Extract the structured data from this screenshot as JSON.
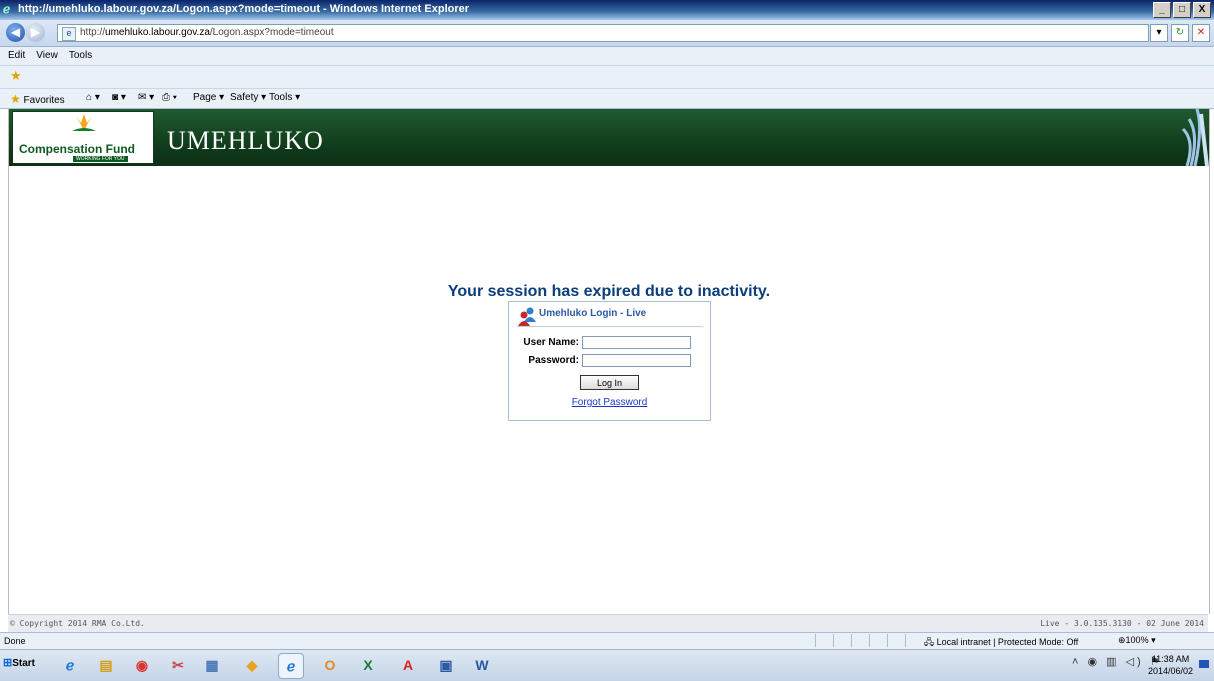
{
  "window": {
    "title": "http://umehluko.labour.gov.za/Logon.aspx?mode=timeout - Windows Internet Explorer",
    "buttons": [
      "_",
      "□",
      "X"
    ]
  },
  "address_bar": {
    "url_prefix": "http://",
    "url_host": "umehluko.labour.gov.za",
    "url_path": "/Logon.aspx?mode=timeout"
  },
  "menu": [
    "Edit",
    "View",
    "Tools"
  ],
  "command_bar": {
    "favorites": "Favorites",
    "page": "Page ▾",
    "safety": "Safety ▾",
    "tools": "Tools ▾"
  },
  "banner": {
    "logo_text": "Compensation Fund",
    "logo_tag": "WORKING FOR YOU",
    "app_name": "UMEHLUKO"
  },
  "main": {
    "session_message": "Your session has expired due to inactivity.",
    "login": {
      "header": "Umehluko Login - Live",
      "username_label": "User Name:",
      "password_label": "Password:",
      "username_value": "",
      "password_value": "",
      "login_button": "Log In",
      "forgot_link": "Forgot Password"
    }
  },
  "footer": {
    "copyright": "© Copyright 2014 RMA Co.Ltd.",
    "version": "Live - 3.0.135.3130 - 02 June 2014"
  },
  "status_bar": {
    "status": "Done",
    "zone": "Local intranet | Protected Mode: Off",
    "zoom": "100%"
  },
  "taskbar": {
    "start": "Start",
    "time": "11:38 AM",
    "date": "2014/06/02"
  },
  "colors": {
    "banner_green": "#0f3a1a",
    "message_blue": "#0b3e7a",
    "link_blue": "#1a36c8"
  }
}
